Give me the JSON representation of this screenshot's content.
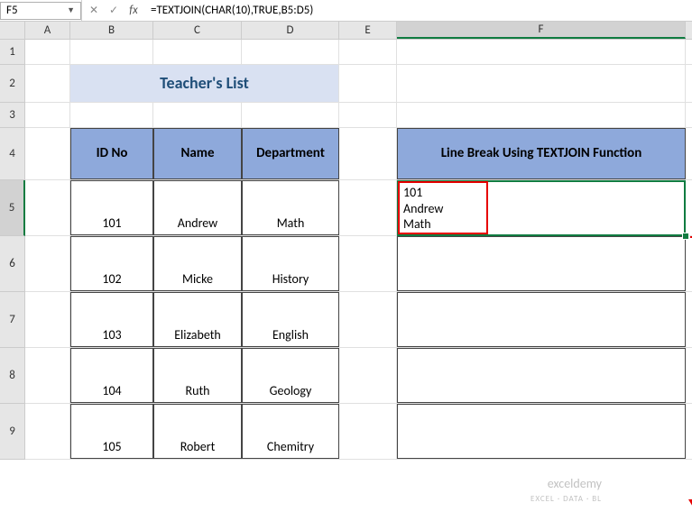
{
  "formula_bar": {
    "cell_ref": "F5",
    "fx_label": "fx",
    "formula": "=TEXTJOIN(CHAR(10),TRUE,B5:D5)",
    "cancel": "✕",
    "enter": "✓"
  },
  "columns": [
    "A",
    "B",
    "C",
    "D",
    "E",
    "F"
  ],
  "rows": [
    "1",
    "2",
    "3",
    "4",
    "5",
    "6",
    "7",
    "8",
    "9"
  ],
  "selected_col": "F",
  "selected_row": "5",
  "title": "Teacher's List",
  "table": {
    "headers": {
      "b": "ID No",
      "c": "Name",
      "d": "Department"
    },
    "rows": [
      {
        "b": "101",
        "c": "Andrew",
        "d": "Math"
      },
      {
        "b": "102",
        "c": "Micke",
        "d": "History"
      },
      {
        "b": "103",
        "c": "Elizabeth",
        "d": "English"
      },
      {
        "b": "104",
        "c": "Ruth",
        "d": "Geology"
      },
      {
        "b": "105",
        "c": "Robert",
        "d": "Chemitry"
      }
    ]
  },
  "result_col": {
    "header": "Line Break Using TEXTJOIN Function",
    "rows": [
      "101\nAndrew\nMath",
      "",
      "",
      "",
      ""
    ]
  },
  "watermark": {
    "main": "exceldemy",
    "sub": "EXCEL · DATA · BL"
  }
}
